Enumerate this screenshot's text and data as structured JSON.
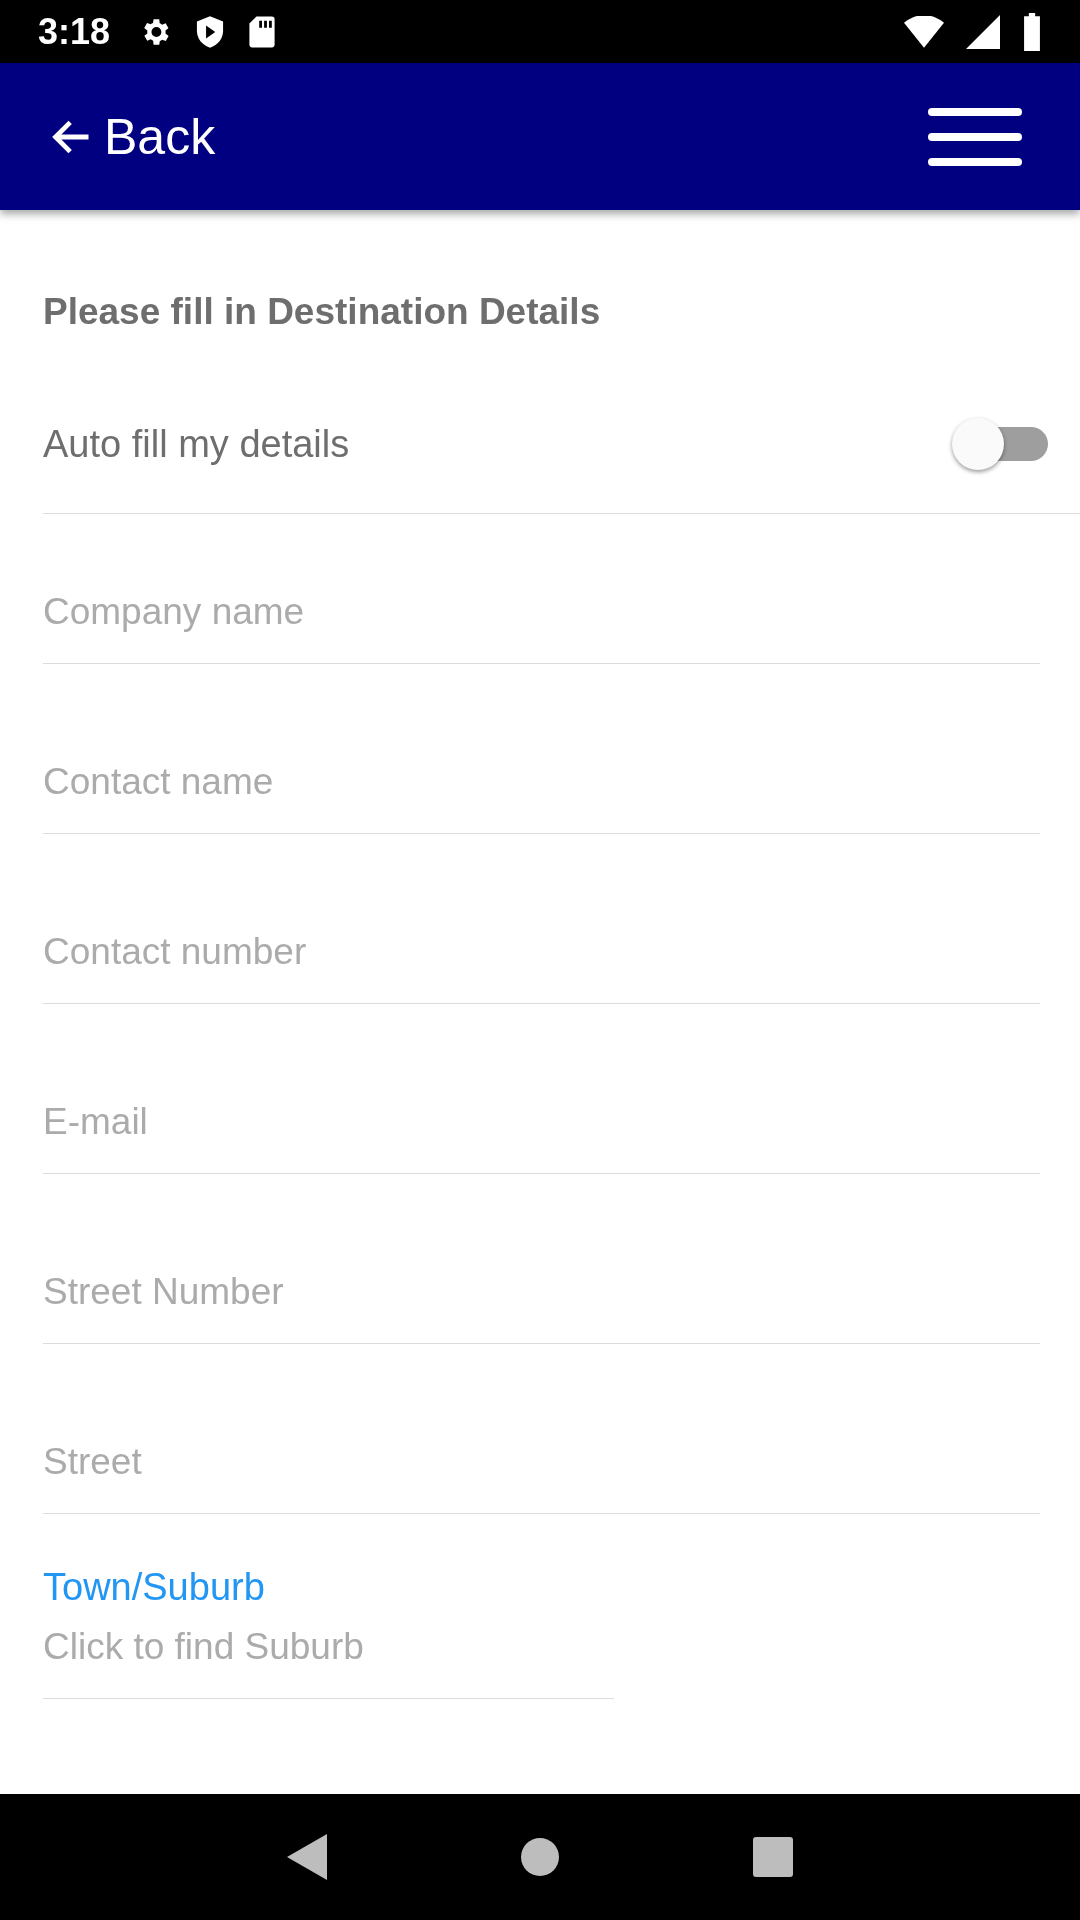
{
  "status_bar": {
    "time": "3:18"
  },
  "app_bar": {
    "back_label": "Back"
  },
  "form": {
    "heading": "Please fill in Destination Details",
    "auto_fill": {
      "label": "Auto fill my details",
      "on": false
    },
    "fields": [
      {
        "placeholder": "Company name"
      },
      {
        "placeholder": "Contact name"
      },
      {
        "placeholder": "Contact number"
      },
      {
        "placeholder": "E-mail"
      },
      {
        "placeholder": "Street Number"
      },
      {
        "placeholder": "Street"
      }
    ],
    "town": {
      "label": "Town/Suburb",
      "placeholder": "Click to find Suburb"
    }
  }
}
